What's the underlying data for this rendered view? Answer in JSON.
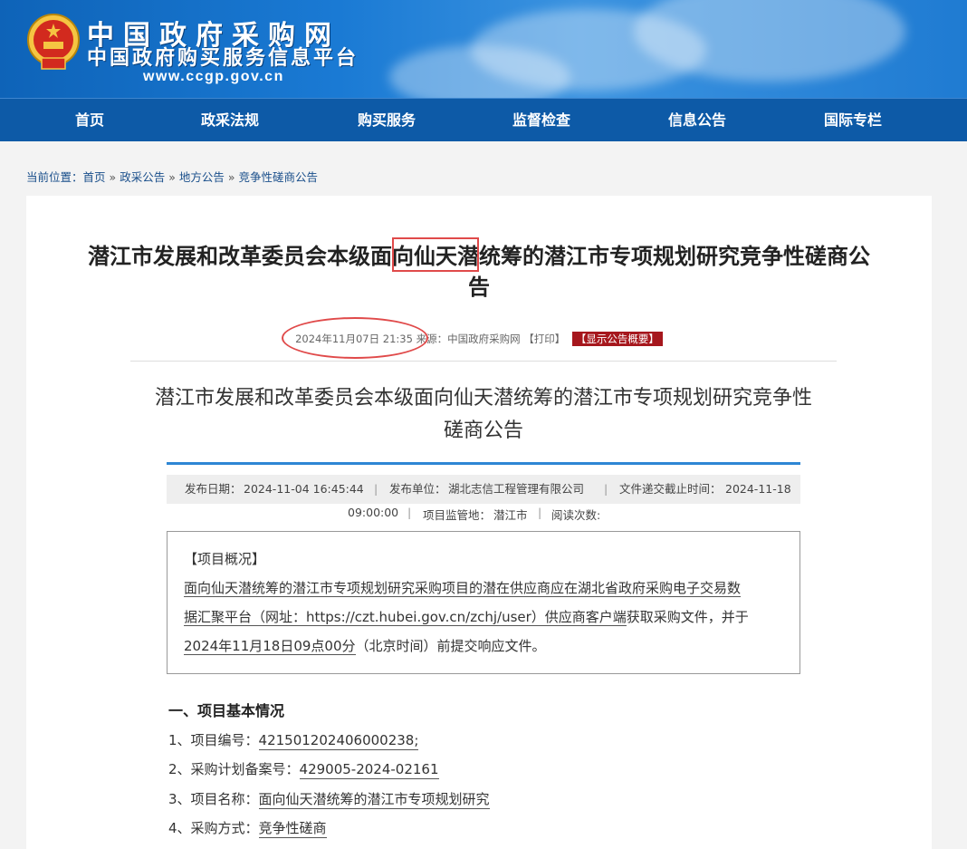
{
  "header": {
    "site_name": "中国政府采购网",
    "site_subtitle": "中国政府购买服务信息平台",
    "site_url": "www.ccgp.gov.cn"
  },
  "nav": [
    "首页",
    "政采法规",
    "购买服务",
    "监督检查",
    "信息公告",
    "国际专栏"
  ],
  "breadcrumb": {
    "prefix": "当前位置：",
    "items": [
      "首页",
      "政采公告",
      "地方公告",
      "竞争性磋商公告"
    ],
    "separator": "»"
  },
  "article": {
    "title_line1": "潜江市发展和改革委员会本级面向仙天潜统筹的潜江市专项规划研究竞争性磋商公",
    "title_line2": "告",
    "meta_datetime": "2024年11月07日 21:35",
    "meta_source_label": "来源：",
    "meta_source": "中国政府采购网",
    "meta_print": "【打印】",
    "meta_summary_tag": "【显示公告概要】",
    "doc_title": "潜江市发展和改革委员会本级面向仙天潜统筹的潜江市专项规划研究竞争性磋商公告",
    "info": {
      "publish_date_label": "发布日期：",
      "publish_date": "2024-11-04 16:45:44",
      "publisher_label": "发布单位：",
      "publisher": "湖北志信工程管理有限公司",
      "deadline_label": "文件递交截止时间：",
      "deadline_date": "2024-11-18",
      "deadline_time": "09:00:00",
      "regulator_label": "项目监管地：",
      "regulator": "潜江市",
      "views_label": "阅读次数:",
      "separator": "|"
    },
    "overview": {
      "heading": "【项目概况】",
      "text_line1": "面向仙天潜统筹的潜江市专项规划研究采购项目的潜在供应商应在湖北省政府采购电子交易数",
      "text_line2a": "据汇聚平台（网址：https://czt.hubei.gov.cn/zchj/user）供应商客户端",
      "text_line2b": "获取采购文件，并于",
      "text_line3a": "2024年11月18日09点00分",
      "text_line3b": "（北京时间）前提交响应文件。"
    },
    "section1": {
      "heading": "一、项目基本情况",
      "items": [
        {
          "label": "1、项目编号：",
          "value": "421501202406000238;"
        },
        {
          "label": "2、采购计划备案号：",
          "value": "429005-2024-02161"
        },
        {
          "label": "3、项目名称：",
          "value": "面向仙天潜统筹的潜江市专项规划研究"
        },
        {
          "label": "4、采购方式：",
          "value": "竞争性磋商"
        }
      ]
    }
  },
  "colors": {
    "nav_bg": "#0d5aa7",
    "annotation_red": "#e04a4a",
    "tag_red": "#a6171d",
    "accent_blue": "#2e86d4"
  }
}
